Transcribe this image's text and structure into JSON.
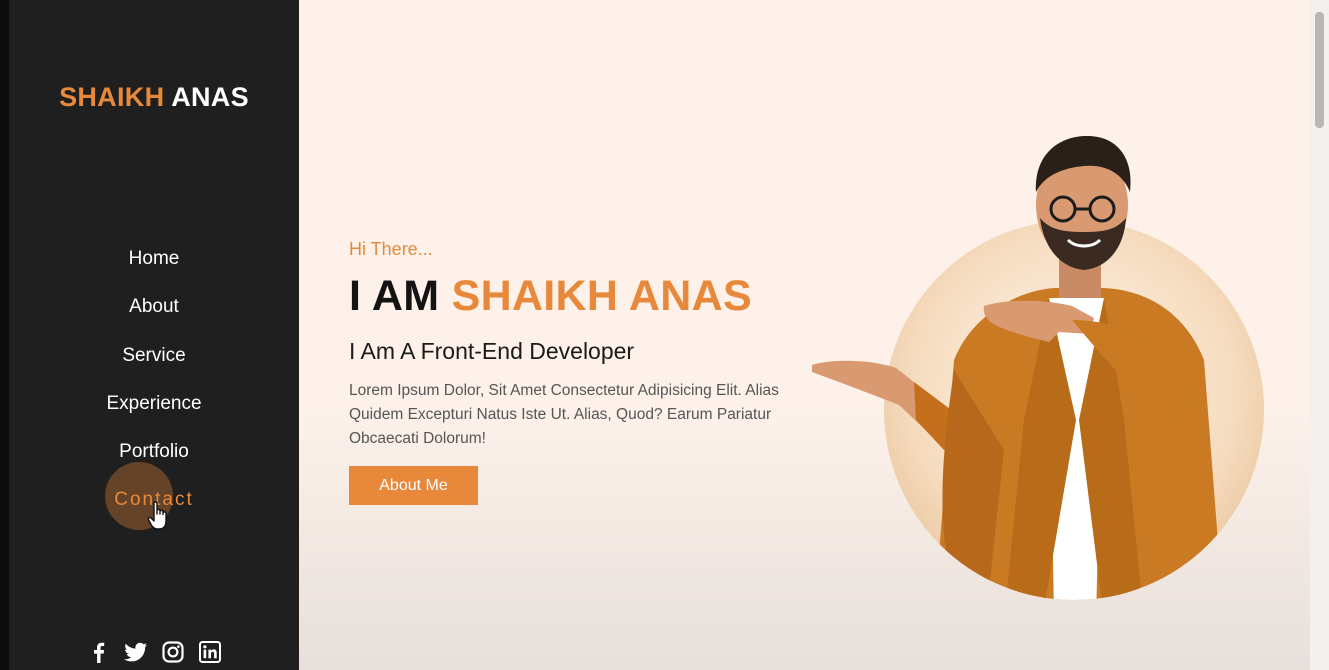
{
  "sidebar": {
    "logo": {
      "first": "SHAIKH",
      "last": "ANAS"
    },
    "nav": [
      {
        "label": "Home"
      },
      {
        "label": "About"
      },
      {
        "label": "Service"
      },
      {
        "label": "Experience"
      },
      {
        "label": "Portfolio"
      },
      {
        "label": "Contact",
        "active": true
      }
    ],
    "social_icons": [
      "facebook-icon",
      "twitter-icon",
      "instagram-icon",
      "linkedin-icon"
    ]
  },
  "hero": {
    "greeting": "Hi There...",
    "headline_prefix": "I AM",
    "headline_name": "SHAIKH ANAS",
    "subheading": "I Am A Front-End Developer",
    "paragraph": "Lorem Ipsum Dolor, Sit Amet Consectetur Adipisicing Elit. Alias Quidem Excepturi Natus Iste Ut. Alias, Quod? Earum Pariatur Obcaecati Dolorum!",
    "button_label": "About Me"
  },
  "colors": {
    "accent": "#e8883a",
    "sidebar_bg": "#1f1f1f",
    "page_bg": "#fdf1ea"
  }
}
